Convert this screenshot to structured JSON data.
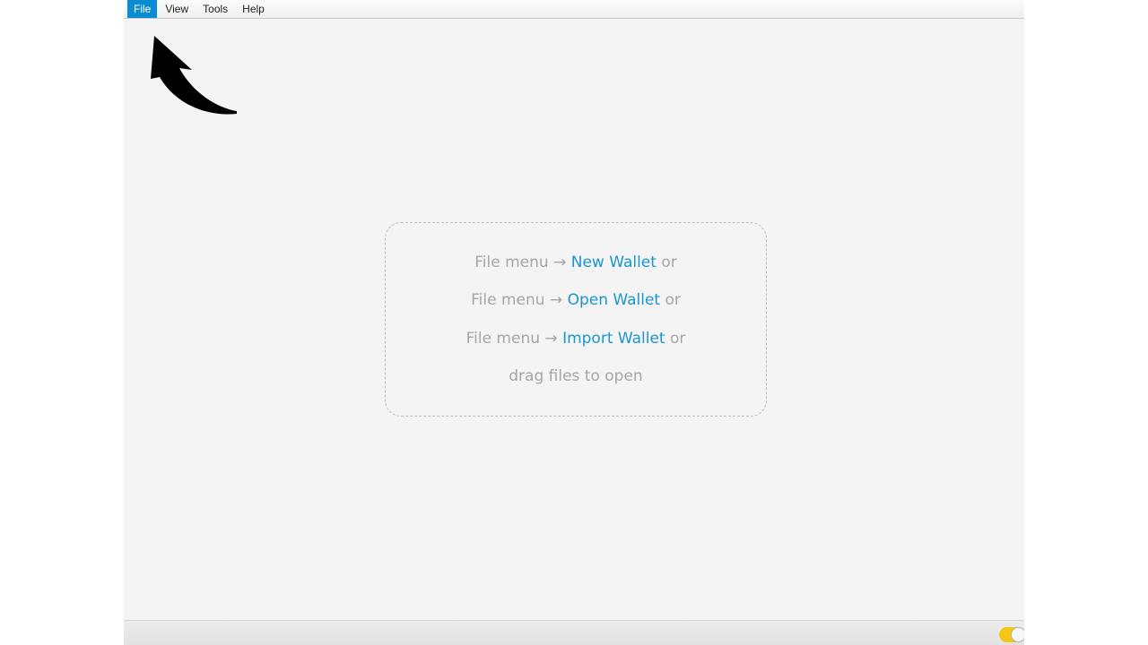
{
  "menubar": {
    "items": [
      {
        "label": "File",
        "active": true
      },
      {
        "label": "View",
        "active": false
      },
      {
        "label": "Tools",
        "active": false
      },
      {
        "label": "Help",
        "active": false
      }
    ]
  },
  "dropzone": {
    "line1": {
      "prefix": "File menu → ",
      "link": "New Wallet",
      "suffix": " or"
    },
    "line2": {
      "prefix": "File menu → ",
      "link": "Open Wallet",
      "suffix": " or"
    },
    "line3": {
      "prefix": "File menu → ",
      "link": "Import Wallet",
      "suffix": " or"
    },
    "line4": {
      "text": "drag files to open"
    }
  },
  "colors": {
    "accent": "#0a8cd2",
    "link": "#1a96cf",
    "hint_text": "#a6a6a6",
    "toggle": "#f5c518"
  },
  "icons": {
    "arrow": "curved-arrow-pointer-icon",
    "toggle": "toggle-switch-icon"
  }
}
